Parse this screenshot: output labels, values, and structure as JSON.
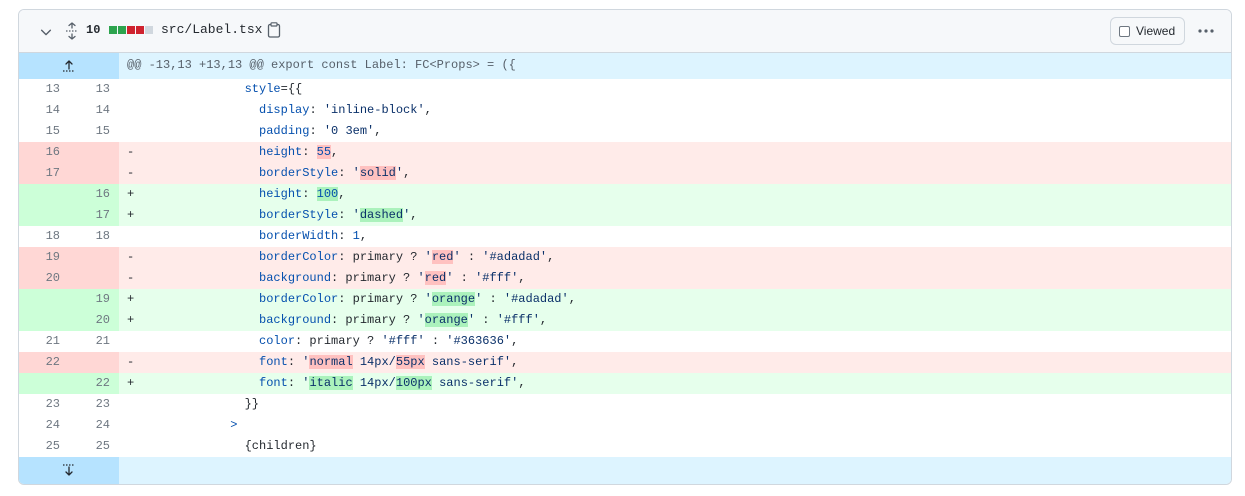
{
  "header": {
    "changes_count": "10",
    "file_path": "src/Label.tsx",
    "viewed_label": "Viewed",
    "diffstat_colors": [
      "#2da44e",
      "#2da44e",
      "#cf222e",
      "#cf222e",
      "#d0d7de"
    ]
  },
  "hunk": {
    "header": "@@ -13,13 +13,13 @@ export const Label: FC<Props> = ({"
  },
  "lines": [
    {
      "type": "ctx",
      "old": "13",
      "new": "13",
      "sign": "",
      "parts": [
        {
          "t": "        "
        },
        {
          "t": "style",
          "c": "k"
        },
        {
          "t": "={{"
        }
      ]
    },
    {
      "type": "ctx",
      "old": "14",
      "new": "14",
      "sign": "",
      "parts": [
        {
          "t": "          "
        },
        {
          "t": "display",
          "c": "k"
        },
        {
          "t": ": "
        },
        {
          "t": "'inline-block'",
          "c": "s"
        },
        {
          "t": ","
        }
      ]
    },
    {
      "type": "ctx",
      "old": "15",
      "new": "15",
      "sign": "",
      "parts": [
        {
          "t": "          "
        },
        {
          "t": "padding",
          "c": "k"
        },
        {
          "t": ": "
        },
        {
          "t": "'0 3em'",
          "c": "s"
        },
        {
          "t": ","
        }
      ]
    },
    {
      "type": "del",
      "old": "16",
      "new": "",
      "sign": "-",
      "parts": [
        {
          "t": "          "
        },
        {
          "t": "height",
          "c": "k"
        },
        {
          "t": ": "
        },
        {
          "t": "55",
          "c": "n",
          "hl": true
        },
        {
          "t": ","
        }
      ]
    },
    {
      "type": "del",
      "old": "17",
      "new": "",
      "sign": "-",
      "parts": [
        {
          "t": "          "
        },
        {
          "t": "borderStyle",
          "c": "k"
        },
        {
          "t": ": "
        },
        {
          "t": "'",
          "c": "s"
        },
        {
          "t": "solid",
          "c": "s",
          "hl": true
        },
        {
          "t": "'",
          "c": "s"
        },
        {
          "t": ","
        }
      ]
    },
    {
      "type": "add",
      "old": "",
      "new": "16",
      "sign": "+",
      "parts": [
        {
          "t": "          "
        },
        {
          "t": "height",
          "c": "k"
        },
        {
          "t": ": "
        },
        {
          "t": "100",
          "c": "n",
          "hl": true
        },
        {
          "t": ","
        }
      ]
    },
    {
      "type": "add",
      "old": "",
      "new": "17",
      "sign": "+",
      "parts": [
        {
          "t": "          "
        },
        {
          "t": "borderStyle",
          "c": "k"
        },
        {
          "t": ": "
        },
        {
          "t": "'",
          "c": "s"
        },
        {
          "t": "dashed",
          "c": "s",
          "hl": true
        },
        {
          "t": "'",
          "c": "s"
        },
        {
          "t": ","
        }
      ]
    },
    {
      "type": "ctx",
      "old": "18",
      "new": "18",
      "sign": "",
      "parts": [
        {
          "t": "          "
        },
        {
          "t": "borderWidth",
          "c": "k"
        },
        {
          "t": ": "
        },
        {
          "t": "1",
          "c": "n"
        },
        {
          "t": ","
        }
      ]
    },
    {
      "type": "del",
      "old": "19",
      "new": "",
      "sign": "-",
      "parts": [
        {
          "t": "          "
        },
        {
          "t": "borderColor",
          "c": "k"
        },
        {
          "t": ": primary ? "
        },
        {
          "t": "'",
          "c": "s"
        },
        {
          "t": "red",
          "c": "s",
          "hl": true
        },
        {
          "t": "'",
          "c": "s"
        },
        {
          "t": " : "
        },
        {
          "t": "'#adadad'",
          "c": "s"
        },
        {
          "t": ","
        }
      ]
    },
    {
      "type": "del",
      "old": "20",
      "new": "",
      "sign": "-",
      "parts": [
        {
          "t": "          "
        },
        {
          "t": "background",
          "c": "k"
        },
        {
          "t": ": primary ? "
        },
        {
          "t": "'",
          "c": "s"
        },
        {
          "t": "red",
          "c": "s",
          "hl": true
        },
        {
          "t": "'",
          "c": "s"
        },
        {
          "t": " : "
        },
        {
          "t": "'#fff'",
          "c": "s"
        },
        {
          "t": ","
        }
      ]
    },
    {
      "type": "add",
      "old": "",
      "new": "19",
      "sign": "+",
      "parts": [
        {
          "t": "          "
        },
        {
          "t": "borderColor",
          "c": "k"
        },
        {
          "t": ": primary ? "
        },
        {
          "t": "'",
          "c": "s"
        },
        {
          "t": "orange",
          "c": "s",
          "hl": true
        },
        {
          "t": "'",
          "c": "s"
        },
        {
          "t": " : "
        },
        {
          "t": "'#adadad'",
          "c": "s"
        },
        {
          "t": ","
        }
      ]
    },
    {
      "type": "add",
      "old": "",
      "new": "20",
      "sign": "+",
      "parts": [
        {
          "t": "          "
        },
        {
          "t": "background",
          "c": "k"
        },
        {
          "t": ": primary ? "
        },
        {
          "t": "'",
          "c": "s"
        },
        {
          "t": "orange",
          "c": "s",
          "hl": true
        },
        {
          "t": "'",
          "c": "s"
        },
        {
          "t": " : "
        },
        {
          "t": "'#fff'",
          "c": "s"
        },
        {
          "t": ","
        }
      ]
    },
    {
      "type": "ctx",
      "old": "21",
      "new": "21",
      "sign": "",
      "parts": [
        {
          "t": "          "
        },
        {
          "t": "color",
          "c": "k"
        },
        {
          "t": ": primary ? "
        },
        {
          "t": "'#fff'",
          "c": "s"
        },
        {
          "t": " : "
        },
        {
          "t": "'#363636'",
          "c": "s"
        },
        {
          "t": ","
        }
      ]
    },
    {
      "type": "del",
      "old": "22",
      "new": "",
      "sign": "-",
      "parts": [
        {
          "t": "          "
        },
        {
          "t": "font",
          "c": "k"
        },
        {
          "t": ": "
        },
        {
          "t": "'",
          "c": "s"
        },
        {
          "t": "normal",
          "c": "s",
          "hl": true
        },
        {
          "t": " 14px/",
          "c": "s"
        },
        {
          "t": "55px",
          "c": "s",
          "hl": true
        },
        {
          "t": " sans-serif'",
          "c": "s"
        },
        {
          "t": ","
        }
      ]
    },
    {
      "type": "add",
      "old": "",
      "new": "22",
      "sign": "+",
      "parts": [
        {
          "t": "          "
        },
        {
          "t": "font",
          "c": "k"
        },
        {
          "t": ": "
        },
        {
          "t": "'",
          "c": "s"
        },
        {
          "t": "italic",
          "c": "s",
          "hl": true
        },
        {
          "t": " 14px/",
          "c": "s"
        },
        {
          "t": "100px",
          "c": "s",
          "hl": true
        },
        {
          "t": " sans-serif'",
          "c": "s"
        },
        {
          "t": ","
        }
      ]
    },
    {
      "type": "ctx",
      "old": "23",
      "new": "23",
      "sign": "",
      "parts": [
        {
          "t": "        }}"
        }
      ]
    },
    {
      "type": "ctx",
      "old": "24",
      "new": "24",
      "sign": "",
      "parts": [
        {
          "t": "      "
        },
        {
          "t": ">",
          "c": "k"
        }
      ]
    },
    {
      "type": "ctx",
      "old": "25",
      "new": "25",
      "sign": "",
      "parts": [
        {
          "t": "        {children}"
        }
      ]
    }
  ]
}
